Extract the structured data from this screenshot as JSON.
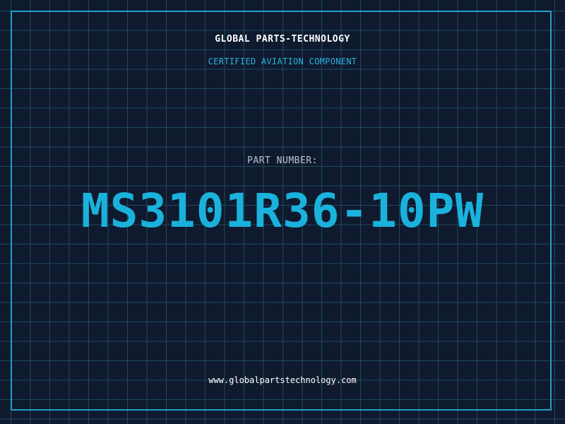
{
  "header": {
    "company": "GLOBAL PARTS-TECHNOLOGY",
    "tagline": "CERTIFIED AVIATION COMPONENT"
  },
  "part": {
    "label": "PART NUMBER:",
    "number": "MS3101R36-10PW"
  },
  "footer": {
    "website": "www.globalpartstechnology.com"
  },
  "colors": {
    "background": "#0f1a2e",
    "grid": "#1f4a5e",
    "accent": "#1ab2dc",
    "frame": "#1fa0c8",
    "text": "#ffffff",
    "muted": "#b9c4d0"
  }
}
